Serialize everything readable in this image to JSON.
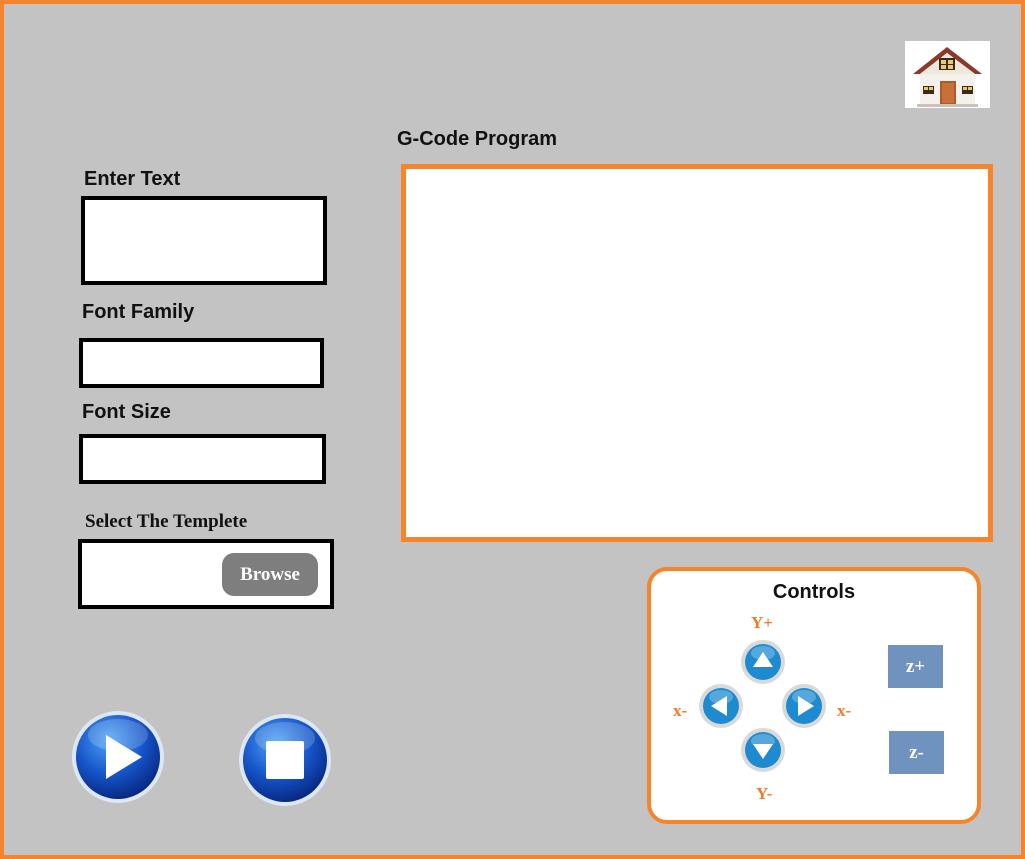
{
  "form": {
    "enter_text_label": "Enter Text",
    "enter_text_value": "",
    "font_family_label": "Font Family",
    "font_family_value": "",
    "font_size_label": "Font Size",
    "font_size_value": "",
    "template_label": "Select The Templete",
    "template_value": "",
    "browse_label": "Browse"
  },
  "gcode": {
    "title": "G-Code Program",
    "value": ""
  },
  "controls": {
    "title": "Controls",
    "y_plus": "Y+",
    "y_minus": "Y-",
    "x_minus": "x-",
    "x_plus": "x-",
    "z_plus": "z+",
    "z_minus": "z-"
  },
  "icons": {
    "home": "home-icon",
    "play": "play-icon",
    "stop": "stop-icon",
    "up": "arrow-up-icon",
    "down": "arrow-down-icon",
    "left": "arrow-left-icon",
    "right": "arrow-right-icon"
  },
  "colors": {
    "accent_orange": "#F5842B",
    "background": "#C3C3C3",
    "z_button": "#7092BE",
    "browse_button": "#7E7E7E",
    "arrow_blue": "#1E8BD0"
  }
}
